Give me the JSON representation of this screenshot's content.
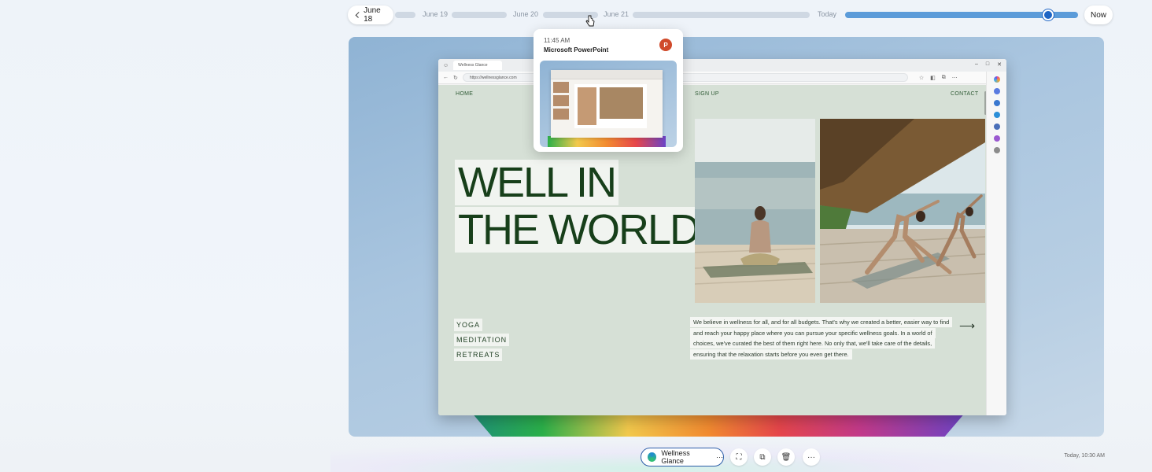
{
  "timeline": {
    "back_label": "June 18",
    "dates": [
      "June 19",
      "June 20",
      "June 21",
      "Today"
    ],
    "now_label": "Now",
    "position": 0.87
  },
  "popup": {
    "time": "11:45 AM",
    "app_name": "Microsoft PowerPoint",
    "app_icon": "powerpoint-icon"
  },
  "browser": {
    "tab_title": "Wellness Glance",
    "url": "https://wellnessglance.com"
  },
  "website": {
    "nav": [
      "HOME",
      "SIGN UP",
      "CONTACT"
    ],
    "hero_lines": [
      "WELL IN",
      "THE WORLD"
    ],
    "menu": [
      "YOGA",
      "MEDITATION",
      "RETREATS"
    ],
    "blurb": "We believe in wellness for all, and for all budgets. That's why we created a better, easier way to find and reach your happy place where you can pursue your specific wellness goals. In a world of choices, we've curated the best of them right here. No only that, we'll take care of the details, ensuring that the relaxation starts before you even get there."
  },
  "toolbar": {
    "app_chip_label": "Wellness Glance",
    "more_label": "···",
    "timestamp": "Today, 10:30 AM"
  },
  "colors": {
    "accent": "#1d64c4",
    "site_green": "#173f1a",
    "site_bg": "#d6e0d6"
  }
}
